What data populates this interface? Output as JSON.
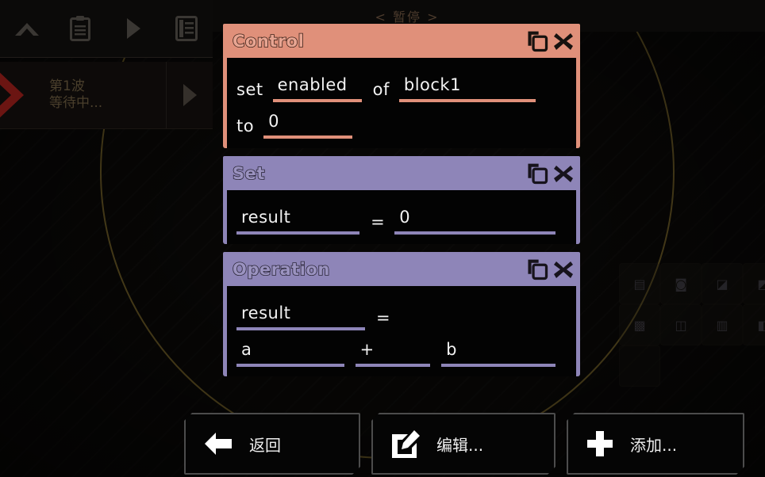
{
  "app": {
    "pause_label": "< 暂停 >"
  },
  "toolbar": {
    "icons": [
      {
        "name": "chevron-up-icon",
        "glyph": "chevron-up"
      },
      {
        "name": "clipboard-icon",
        "glyph": "clipboard"
      },
      {
        "name": "play-icon",
        "glyph": "play"
      },
      {
        "name": "document-icon",
        "glyph": "document"
      }
    ]
  },
  "wave": {
    "line1": "第1波",
    "line2": "等待中...",
    "play_icon": "play-icon",
    "chevron_icon": "chevron-right-icon"
  },
  "blocks": [
    {
      "id": "control",
      "title": "Control",
      "accent": "#e0907a",
      "theme": "control",
      "copy_icon": "copy-icon",
      "close_icon": "close-icon",
      "rows": [
        {
          "tokens": [
            {
              "kind": "static",
              "text": "set"
            },
            {
              "kind": "field",
              "text": "enabled",
              "size": "w-sm"
            },
            {
              "kind": "static",
              "text": "of"
            },
            {
              "kind": "field",
              "text": "block1",
              "size": "w-lg"
            }
          ]
        },
        {
          "tokens": [
            {
              "kind": "static",
              "text": "to"
            },
            {
              "kind": "field",
              "text": "0",
              "size": "w-sm"
            }
          ]
        }
      ]
    },
    {
      "id": "set",
      "title": "Set",
      "accent": "#8e85b8",
      "theme": "purple",
      "copy_icon": "copy-icon",
      "close_icon": "close-icon",
      "rows": [
        {
          "tokens": [
            {
              "kind": "field",
              "text": "result",
              "size": "w-res"
            },
            {
              "kind": "static",
              "text": "="
            },
            {
              "kind": "field",
              "text": "0",
              "size": "w-xl"
            }
          ]
        }
      ]
    },
    {
      "id": "operation",
      "title": "Operation",
      "accent": "#8e85b8",
      "theme": "purple",
      "copy_icon": "copy-icon",
      "close_icon": "close-icon",
      "rows": [
        {
          "tokens": [
            {
              "kind": "field",
              "text": "result",
              "size": "w-res"
            },
            {
              "kind": "static",
              "text": "="
            }
          ]
        },
        {
          "tokens": [
            {
              "kind": "field",
              "text": "a",
              "size": "w-res"
            },
            {
              "kind": "field",
              "text": "+",
              "size": "w-sm"
            },
            {
              "kind": "field",
              "text": "b",
              "size": "w-lg"
            }
          ]
        }
      ]
    }
  ],
  "actions": [
    {
      "id": "back",
      "label": "返回",
      "icon": "arrow-left-icon"
    },
    {
      "id": "edit",
      "label": "编辑...",
      "icon": "edit-pencil-icon"
    },
    {
      "id": "add",
      "label": "添加...",
      "icon": "plus-icon"
    }
  ],
  "palette": {
    "cells": [
      {
        "name": "palette-item-conveyor",
        "glyph": "▤"
      },
      {
        "name": "palette-item-router",
        "glyph": "◙"
      },
      {
        "name": "palette-item-drill",
        "glyph": "◪"
      },
      {
        "name": "palette-item-duct",
        "glyph": "◩"
      },
      {
        "name": "palette-item-power",
        "glyph": "▩"
      },
      {
        "name": "palette-item-node",
        "glyph": "◫"
      },
      {
        "name": "palette-item-wall",
        "glyph": "▥"
      },
      {
        "name": "palette-item-turret",
        "glyph": "◧"
      },
      {
        "name": "palette-item-empty",
        "glyph": ""
      }
    ]
  },
  "corner_tools": [
    {
      "name": "pin-icon"
    },
    {
      "name": "expand-icon"
    },
    {
      "name": "copy-icon"
    }
  ]
}
